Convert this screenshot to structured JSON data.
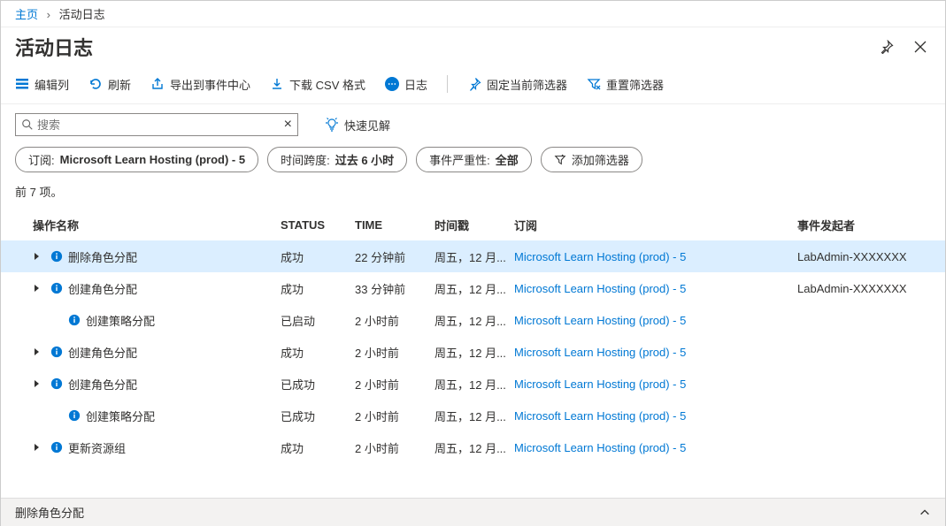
{
  "breadcrumb": {
    "home": "主页",
    "current": "活动日志"
  },
  "title": "活动日志",
  "toolbar": {
    "edit_columns": "编辑列",
    "refresh": "刷新",
    "export_event_hub": "导出到事件中心",
    "download_csv": "下载 CSV 格式",
    "logs": "日志",
    "pin_filter": "固定当前筛选器",
    "reset_filter": "重置筛选器"
  },
  "search": {
    "placeholder": "搜索",
    "clear": "×"
  },
  "quick_insights": "快速见解",
  "filters": {
    "subscription_label": "订阅:",
    "subscription_value": "Microsoft Learn Hosting (prod) - 5",
    "timespan_label": "时间跨度:",
    "timespan_value": "过去 6 小时",
    "severity_label": "事件严重性:",
    "severity_value": "全部",
    "add_filter": "添加筛选器"
  },
  "count_text": "前 7 项。",
  "columns": {
    "operation": "操作名称",
    "status": "STATUS",
    "time": "TIME",
    "timestamp": "时间戳",
    "subscription": "订阅",
    "initiated_by": "事件发起者"
  },
  "rows": [
    {
      "op": "删除角色分配",
      "status": "成功",
      "time": "22 分钟前",
      "ts": "周五，12 月...",
      "sub": "Microsoft Learn Hosting (prod) - 5",
      "by": "LabAdmin-XXXXXXX",
      "expand": true,
      "selected": true
    },
    {
      "op": "创建角色分配",
      "status": "成功",
      "time": "33 分钟前",
      "ts": "周五，12 月...",
      "sub": "Microsoft Learn Hosting (prod) - 5",
      "by": "LabAdmin-XXXXXXX",
      "expand": true,
      "selected": false
    },
    {
      "op": "创建策略分配",
      "status": "已启动",
      "time": "2 小时前",
      "ts": "周五，12 月...",
      "sub": "Microsoft Learn Hosting (prod) - 5",
      "by": "",
      "expand": false,
      "selected": false
    },
    {
      "op": "创建角色分配",
      "status": "成功",
      "time": "2 小时前",
      "ts": "周五，12 月...",
      "sub": "Microsoft Learn Hosting (prod) - 5",
      "by": "",
      "expand": true,
      "selected": false
    },
    {
      "op": "创建角色分配",
      "status": "已成功",
      "time": "2 小时前",
      "ts": "周五，12 月...",
      "sub": "Microsoft Learn Hosting (prod) - 5",
      "by": "",
      "expand": true,
      "selected": false
    },
    {
      "op": "创建策略分配",
      "status": "已成功",
      "time": "2 小时前",
      "ts": "周五，12 月...",
      "sub": "Microsoft Learn Hosting (prod) - 5",
      "by": "",
      "expand": false,
      "selected": false
    },
    {
      "op": "更新资源组",
      "status": "成功",
      "time": "2 小时前",
      "ts": "周五，12 月...",
      "sub": "Microsoft Learn Hosting (prod) - 5",
      "by": "",
      "expand": true,
      "selected": false
    }
  ],
  "footer": {
    "detail_title": "删除角色分配"
  }
}
